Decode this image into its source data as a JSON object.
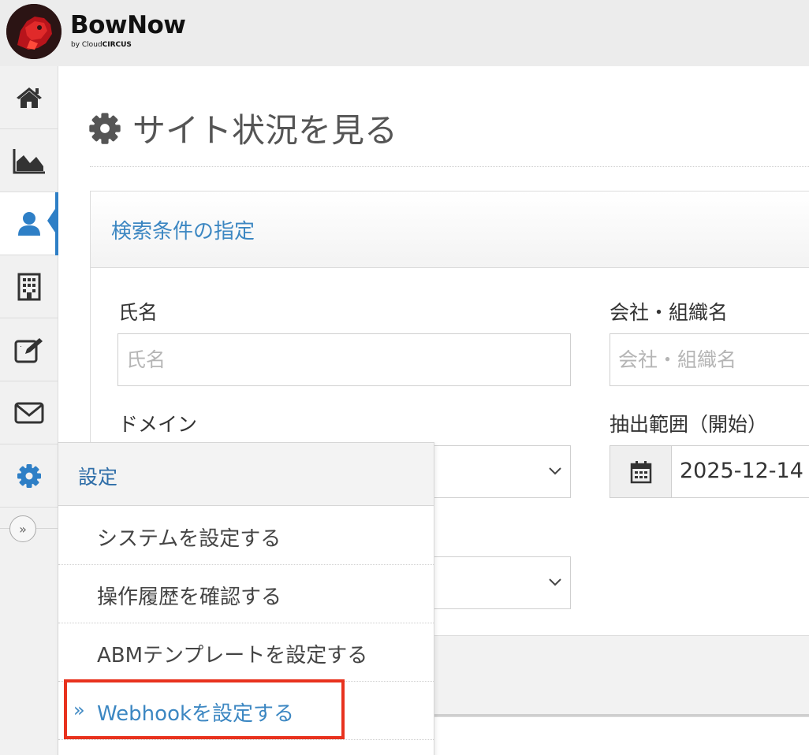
{
  "header": {
    "brand_name": "BowNow",
    "brand_sub_prefix": "by Cloud",
    "brand_sub_suffix": "CIRCUS"
  },
  "sidenav": {
    "items": [
      {
        "icon": "home-icon"
      },
      {
        "icon": "area-chart-icon"
      },
      {
        "icon": "user-icon",
        "active": true
      },
      {
        "icon": "building-icon"
      },
      {
        "icon": "edit-icon"
      },
      {
        "icon": "mail-icon"
      },
      {
        "icon": "gear-icon"
      }
    ],
    "expand_icon": "double-chevron-right-icon",
    "expand_glyph": "»"
  },
  "main": {
    "title": "サイト状況を見る",
    "title_icon": "gear-icon",
    "search_panel": {
      "title": "検索条件の指定",
      "name_label": "氏名",
      "name_placeholder": "氏名",
      "company_label": "会社・組織名",
      "company_placeholder": "会社・組織名",
      "domain_label": "ドメイン",
      "range_start_label": "抽出範囲（開始）",
      "range_start_value": "2025-12-14"
    }
  },
  "settings_menu": {
    "title": "設定",
    "items": [
      {
        "label": "システムを設定する"
      },
      {
        "label": "操作履歴を確認する"
      },
      {
        "label": "ABMテンプレートを設定する"
      },
      {
        "label": "Webhookを設定する",
        "current": true,
        "bullet": "»"
      }
    ]
  },
  "colors": {
    "accent": "#2e7fc6",
    "link": "#3c87c2",
    "highlight": "#e8321e",
    "brand_red": "#c8161d"
  }
}
